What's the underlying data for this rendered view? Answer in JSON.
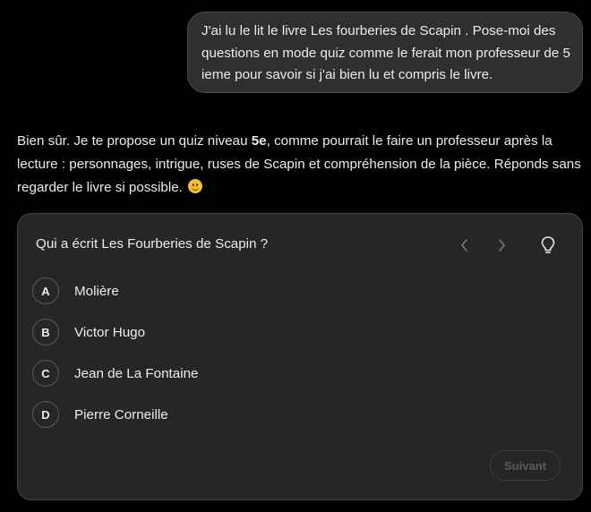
{
  "user_message": {
    "text": "J'ai lu le lit le livre Les fourberies de Scapin . Pose-moi des questions en mode quiz comme le ferait mon professeur de 5 ieme pour savoir si j'ai bien lu et compris le livre."
  },
  "assistant_message": {
    "part1": "Bien sûr. Je te propose un quiz niveau ",
    "bold": "5e",
    "part2": ", comme pourrait le faire un professeur après la lecture : personnages, intrigue, ruses de Scapin et compréhension de la pièce. Réponds sans regarder le livre si possible. ",
    "emoji_icon": "slightly-smiling-face-icon"
  },
  "quiz": {
    "question": "Qui a écrit Les Fourberies de Scapin ?",
    "options": [
      {
        "letter": "A",
        "text": "Molière"
      },
      {
        "letter": "B",
        "text": "Victor Hugo"
      },
      {
        "letter": "C",
        "text": "Jean de La Fontaine"
      },
      {
        "letter": "D",
        "text": "Pierre Corneille"
      }
    ],
    "next_label": "Suivant",
    "icons": {
      "prev": "chevron-left-icon",
      "next": "chevron-right-icon",
      "hint": "lightbulb-icon"
    }
  },
  "colors": {
    "background": "#000000",
    "bubble": "#2f2f2f",
    "card": "#262626",
    "text": "#ececec",
    "disabled": "#5c5c5c"
  }
}
